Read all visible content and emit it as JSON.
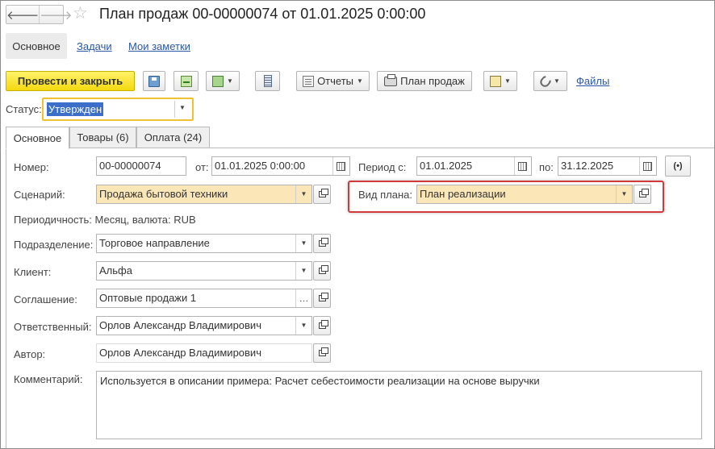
{
  "window": {
    "title": "План продаж 00-00000074 от 01.01.2025 0:00:00",
    "back_glyph": "🡐",
    "forward_glyph": "🡒",
    "star_glyph": "☆"
  },
  "top_tabs": [
    {
      "label": "Основное",
      "active": true
    },
    {
      "label": "Задачи"
    },
    {
      "label": "Мои заметки"
    }
  ],
  "toolbar": {
    "post_close": "Провести и закрыть",
    "reports": "Отчеты",
    "sales_plan": "План продаж",
    "files": "Файлы",
    "icons": [
      "save-icon",
      "post-icon",
      "copy-icon",
      "list-icon",
      "reports-icon",
      "print-icon",
      "doc-icon",
      "paperclip-icon"
    ]
  },
  "status": {
    "label": "Статус:",
    "value": "Утвержден"
  },
  "section_tabs": [
    {
      "label": "Основное",
      "active": true
    },
    {
      "label": "Товары (6)"
    },
    {
      "label": "Оплата (24)"
    }
  ],
  "form": {
    "number_label": "Номер:",
    "number": "00-00000074",
    "from_label": "от:",
    "date": "01.01.2025  0:00:00",
    "period_label": "Период с:",
    "period_from": "01.01.2025",
    "period_to_label": "по:",
    "period_to": "31.12.2025",
    "period_button": "(•)",
    "scenario_label": "Сценарий:",
    "scenario": "Продажа бытовой техники",
    "plan_kind_label": "Вид плана:",
    "plan_kind": "План реализации",
    "periodicity_text": "Периодичность: Месяц, валюта: RUB",
    "division_label": "Подразделение:",
    "division": "Торговое направление",
    "client_label": "Клиент:",
    "client": "Альфа",
    "agreement_label": "Соглашение:",
    "agreement": "Оптовые продажи 1",
    "responsible_label": "Ответственный:",
    "responsible": "Орлов Александр Владимирович",
    "author_label": "Автор:",
    "author": "Орлов Александр Владимирович",
    "comment_label": "Комментарий:",
    "comment": "Используется в описании примера: Расчет себестоимости реализации на основе выручки"
  },
  "colors": {
    "accent_yellow": "#f3d90f",
    "highlight_red": "#d23a3a",
    "link_blue": "#2a57a6",
    "required_field": "#fbe6b8",
    "selection_blue": "#3b6fc9"
  }
}
